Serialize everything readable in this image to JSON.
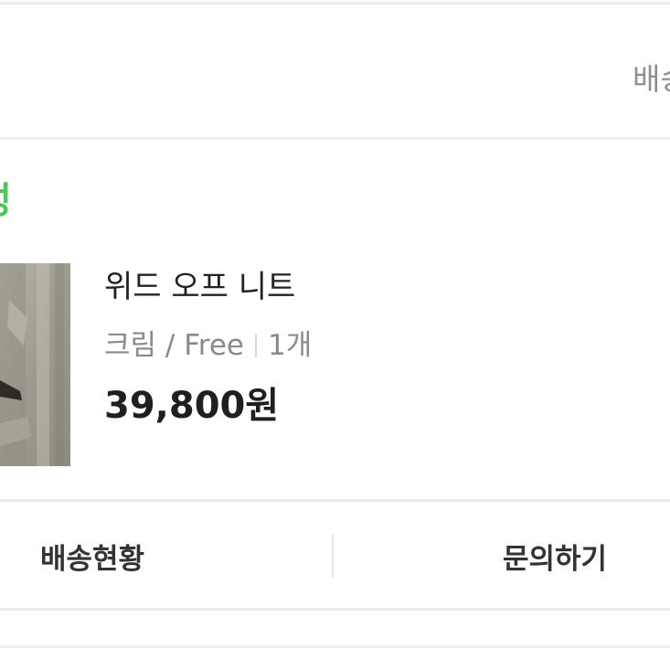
{
  "header": {
    "right_text": "배송"
  },
  "order": {
    "status_text": "성",
    "product": {
      "name": "위드 오프 니트",
      "color": "크림",
      "slash": " / ",
      "size": "Free",
      "quantity": "1개",
      "price": "39,800원"
    }
  },
  "actions": {
    "shipping_status_label": "배송현황",
    "inquiry_label": "문의하기"
  },
  "colors": {
    "status_green": "#52c45a",
    "text_dark": "#222222",
    "text_muted": "#8a8a8a"
  }
}
